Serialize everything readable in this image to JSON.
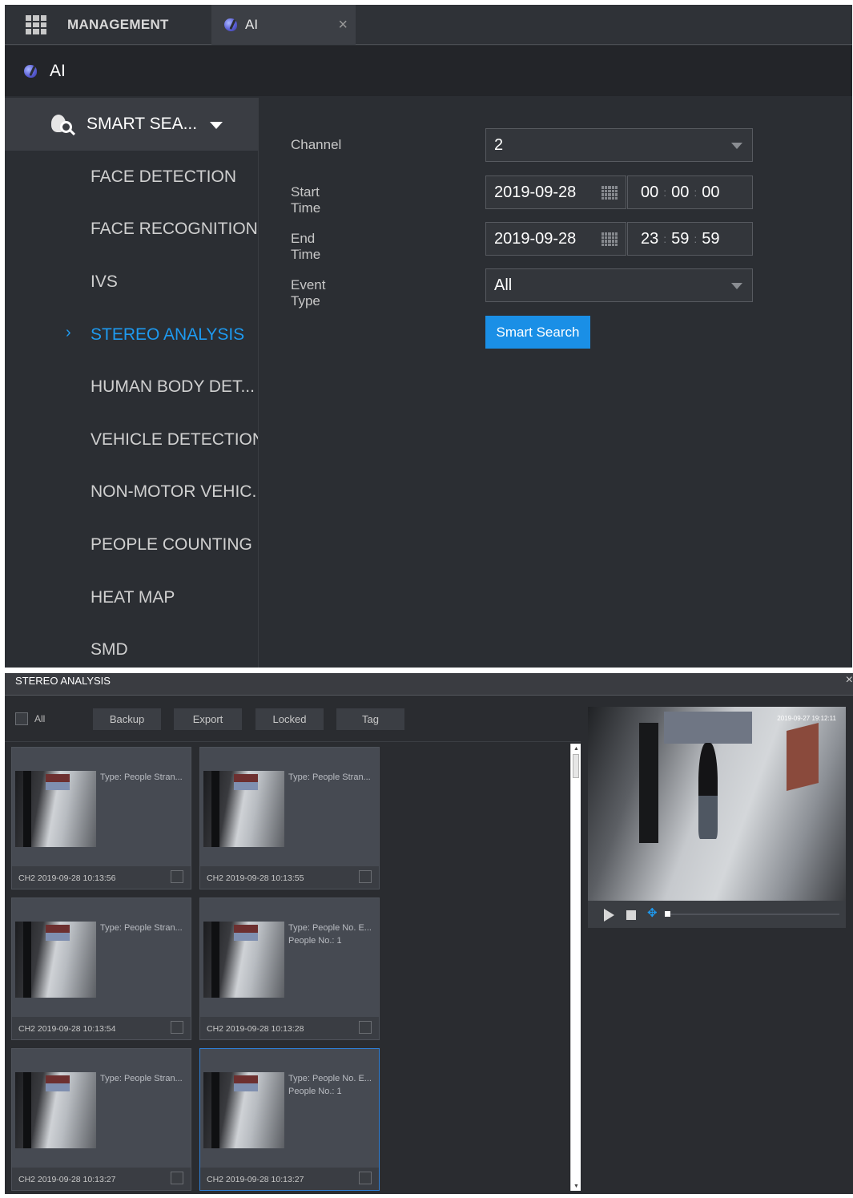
{
  "tabs": {
    "management_label": "MANAGEMENT",
    "ai_label": "AI",
    "close_symbol": "×"
  },
  "title": "AI",
  "sidebar": {
    "header": "SMART SEA...",
    "items": [
      {
        "label": "FACE DETECTION"
      },
      {
        "label": "FACE RECOGNITION"
      },
      {
        "label": "IVS"
      },
      {
        "label": "STEREO ANALYSIS",
        "active": true
      },
      {
        "label": "HUMAN BODY DET..."
      },
      {
        "label": "VEHICLE DETECTION"
      },
      {
        "label": "NON-MOTOR VEHIC..."
      },
      {
        "label": "PEOPLE COUNTING"
      },
      {
        "label": "HEAT MAP"
      },
      {
        "label": "SMD"
      }
    ]
  },
  "form": {
    "channel_label": "Channel",
    "channel_value": "2",
    "start_label": "Start Time",
    "start_date": "2019-09-28",
    "start_h": "00",
    "start_m": "00",
    "start_s": "00",
    "end_label": "End Time",
    "end_date": "2019-09-28",
    "end_h": "23",
    "end_m": "59",
    "end_s": "59",
    "event_label": "Event Type",
    "event_value": "All",
    "search_button": "Smart Search",
    "colon": ":"
  },
  "results": {
    "title": "STEREO ANALYSIS",
    "close_symbol": "×",
    "all_label": "All",
    "toolbar": [
      "Backup",
      "Export",
      "Locked",
      "Tag"
    ],
    "cards": [
      {
        "line1": "Type:   People Stran...",
        "line2": "",
        "stamp": "CH2 2019-09-28 10:13:56"
      },
      {
        "line1": "Type:   People Stran...",
        "line2": "",
        "stamp": "CH2 2019-09-28 10:13:55"
      },
      {
        "line1": "Type:   People Stran...",
        "line2": "",
        "stamp": "CH2 2019-09-28 10:13:54"
      },
      {
        "line1": "Type:   People No. E...",
        "line2": "People No.:    1",
        "stamp": "CH2 2019-09-28 10:13:28"
      },
      {
        "line1": "Type:   People Stran...",
        "line2": "",
        "stamp": "CH2 2019-09-28 10:13:27"
      },
      {
        "line1": "Type:   People No. E...",
        "line2": "People No.:    1",
        "stamp": "CH2 2019-09-28 10:13:27",
        "selected": true
      }
    ],
    "video_osd": "2019-09-27 19:12:11",
    "progress": 0
  }
}
